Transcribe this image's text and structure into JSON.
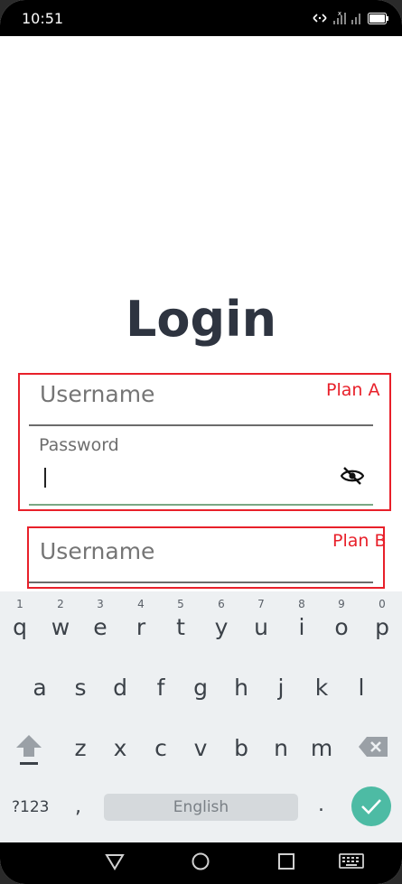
{
  "status_bar": {
    "time": "10:51",
    "icons": [
      "data-transfer-icon",
      "no-signal-icon",
      "wifi-off-icon",
      "battery-icon"
    ]
  },
  "screen": {
    "title": "Login"
  },
  "plan_a": {
    "label": "Plan A",
    "username_placeholder": "Username",
    "password_label": "Password",
    "password_value": "",
    "toggle_icon": "eye-off-icon"
  },
  "plan_b": {
    "label": "Plan B",
    "username_placeholder": "Username"
  },
  "keyboard": {
    "row1": [
      {
        "key": "q",
        "num": "1"
      },
      {
        "key": "w",
        "num": "2"
      },
      {
        "key": "e",
        "num": "3"
      },
      {
        "key": "r",
        "num": "4"
      },
      {
        "key": "t",
        "num": "5"
      },
      {
        "key": "y",
        "num": "6"
      },
      {
        "key": "u",
        "num": "7"
      },
      {
        "key": "i",
        "num": "8"
      },
      {
        "key": "o",
        "num": "9"
      },
      {
        "key": "p",
        "num": "0"
      }
    ],
    "row2": [
      "a",
      "s",
      "d",
      "f",
      "g",
      "h",
      "j",
      "k",
      "l"
    ],
    "row3": [
      "z",
      "x",
      "c",
      "v",
      "b",
      "n",
      "m"
    ],
    "num_switch": "?123",
    "comma": ",",
    "space_label": "English",
    "period": ".",
    "shift_icon": "shift-icon",
    "backspace_icon": "backspace-icon",
    "enter_icon": "checkmark-icon",
    "enter_color": "#4dbba4"
  },
  "nav_bar": {
    "buttons": [
      "back-triangle-icon",
      "home-circle-icon",
      "recents-square-icon",
      "keyboard-icon"
    ]
  },
  "colors": {
    "annotation": "#e8202a",
    "title": "#2e3440",
    "active_underline": "#7aa884"
  }
}
